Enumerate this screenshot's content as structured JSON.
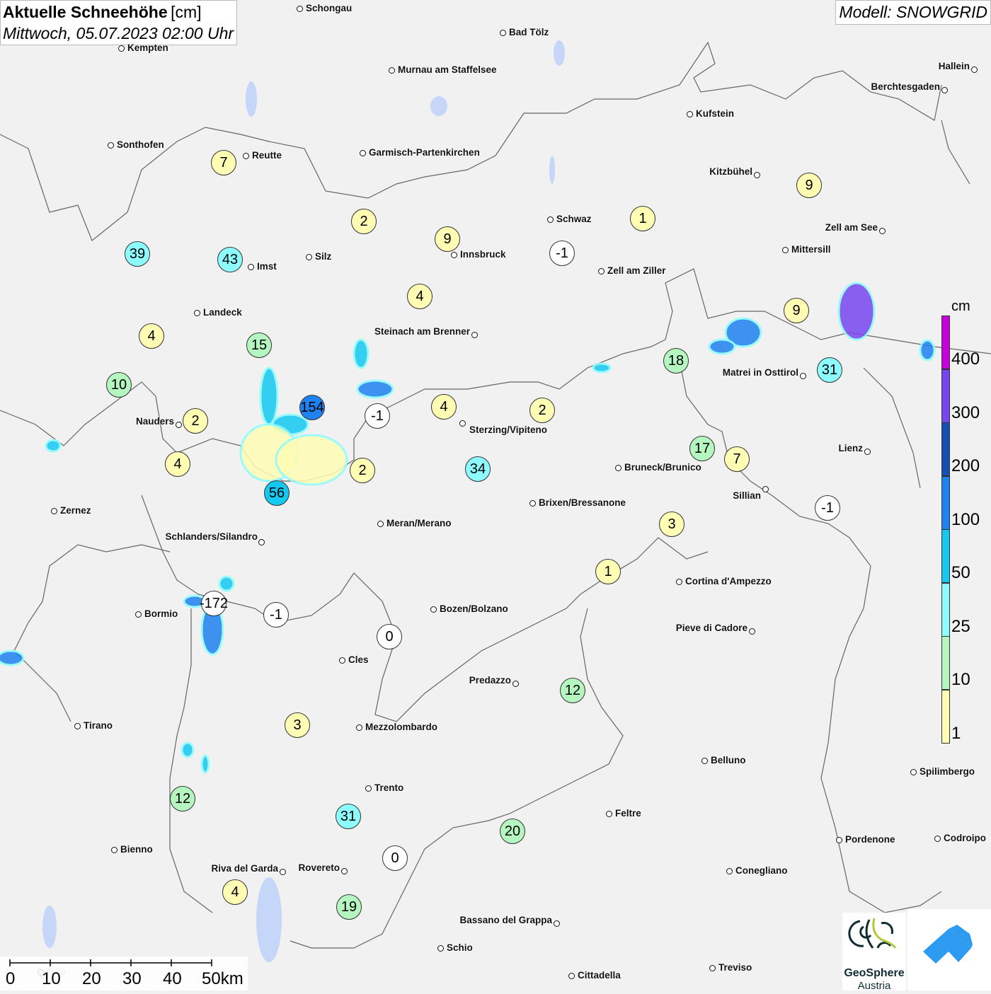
{
  "title": {
    "main": "Aktuelle Schneehöhe",
    "unit": "[cm]",
    "datetime": "Mittwoch, 05.07.2023 02:00 Uhr"
  },
  "model": "Modell: SNOWGRID",
  "legend": {
    "unit": "cm",
    "labels": [
      "400",
      "300",
      "200",
      "100",
      "50",
      "25",
      "10",
      "1"
    ],
    "colors": [
      "#c800dc",
      "#7846f0",
      "#1450b4",
      "#1e82f0",
      "#14c8f0",
      "#8cfcff",
      "#b4f5c0",
      "#fffcb4"
    ]
  },
  "stations": [
    7,
    39,
    43,
    2,
    9,
    -1,
    1,
    9,
    4,
    4,
    15,
    9,
    18,
    31,
    10,
    154,
    -1,
    4,
    2,
    2,
    4,
    2,
    34,
    56,
    17,
    7,
    -1,
    3,
    1,
    -172,
    -1,
    0,
    12,
    3,
    12,
    31,
    20,
    0,
    4,
    19
  ],
  "cities": [
    "Schongau",
    "Bad Tölz",
    "Kempten",
    "Murnau am Staffelsee",
    "Hallein",
    "Berchtesgaden",
    "Kufstein",
    "Sonthofen",
    "Reutte",
    "Garmisch-Partenkirchen",
    "Kitzbühel",
    "Schwaz",
    "Zell am See",
    "Innsbruck",
    "Mittersill",
    "Silz",
    "Imst",
    "Zell am Ziller",
    "Landeck",
    "Steinach am Brenner",
    "Matrei in Osttirol",
    "Nauders",
    "Sterzing/Vipiteno",
    "Lienz",
    "Bruneck/Brunico",
    "Sillian",
    "Brixen/Bressanone",
    "Zernez",
    "Meran/Merano",
    "Schlanders/Silandro",
    "Cortina d'Ampezzo",
    "Bozen/Bolzano",
    "Bormio",
    "Pieve di Cadore",
    "Cles",
    "Predazzo",
    "Tirano",
    "Mezzolombardo",
    "Belluno",
    "Spilimbergo",
    "Trento",
    "Feltre",
    "Pordenone",
    "Codroipo",
    "Bienno",
    "Riva del Garda",
    "Rovereto",
    "Conegliano",
    "Bassano del Grappa",
    "Schio",
    "Treviso",
    "Cittadella",
    "Iseo"
  ],
  "scale": [
    "0",
    "10",
    "20",
    "30",
    "40",
    "50km"
  ],
  "logos": {
    "geosphere": "GeoSphere",
    "geosphere_sub": "Austria"
  }
}
